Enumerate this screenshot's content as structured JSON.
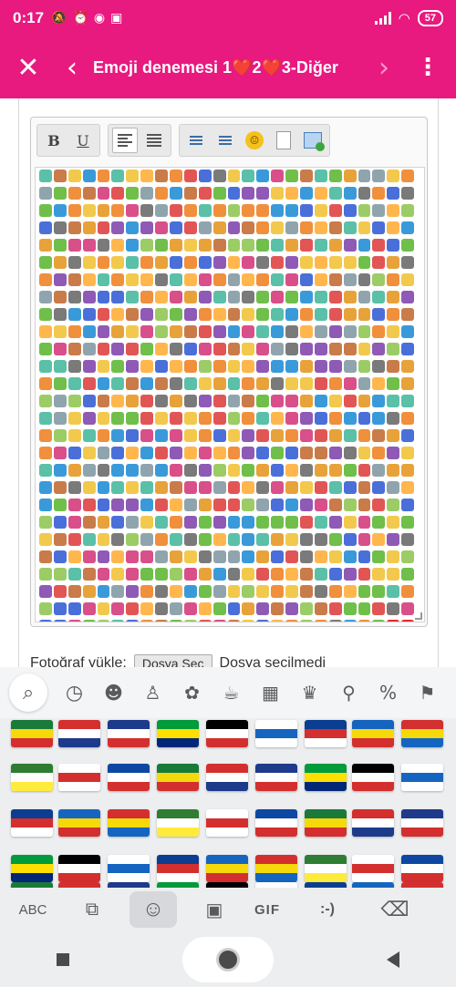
{
  "status_bar": {
    "time": "0:17",
    "battery": "57"
  },
  "app_bar": {
    "title_part1": "Emoji denemesi 1",
    "title_heart": "❤️",
    "title_part2": "2",
    "title_part3": "3-Diğer",
    "close_glyph": "✕",
    "back_glyph": "‹",
    "forward_glyph": "›",
    "menu_glyph": "⋮"
  },
  "editor": {
    "toolbar": {
      "bold": "B",
      "underline": "U"
    }
  },
  "upload": {
    "label": "Fotoğraf yükle:",
    "button": "Dosya Seç",
    "status": "Dosya seçilmedi"
  },
  "keyboard": {
    "categories": [
      "search-icon",
      "recent-icon",
      "smileys-icon",
      "people-icon",
      "animals-icon",
      "food-icon",
      "travel-icon",
      "activities-icon",
      "objects-icon",
      "symbols-icon",
      "flags-icon"
    ],
    "bottom_keys": {
      "abc": "ABC",
      "gif": "GIF",
      "emoticon": ":-)"
    }
  },
  "colors": {
    "accent": "#e8197f",
    "keyboard_bg": "#eceef0"
  }
}
